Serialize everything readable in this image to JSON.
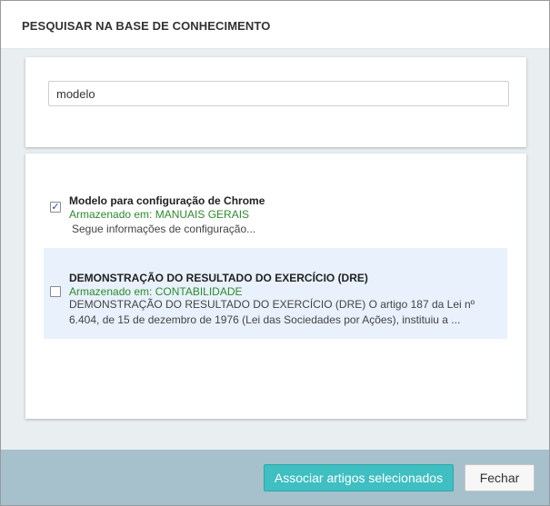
{
  "modal": {
    "title": "PESQUISAR NA BASE DE CONHECIMENTO"
  },
  "search": {
    "value": "modelo"
  },
  "results": [
    {
      "checked": true,
      "title": "Modelo para configuração de Chrome",
      "location": "Armazenado em: MANUAIS GERAIS",
      "snippet": "Segue informações de configuração..."
    },
    {
      "checked": false,
      "title": "DEMONSTRAÇÃO DO RESULTADO DO EXERCÍCIO (DRE)",
      "location": "Armazenado em: CONTABILIDADE",
      "snippet": "DEMONSTRAÇÃO DO RESULTADO DO EXERCÍCIO (DRE)   O artigo 187 da Lei nº 6.404, de 15 de dezembro de 1976 (Lei das Sociedades por Ações), instituiu a ..."
    }
  ],
  "footer": {
    "associate_label": "Associar artigos selecionados",
    "close_label": "Fechar"
  },
  "colors": {
    "primary": "#3fbfc2",
    "location_text": "#2e8a2e",
    "highlight_row": "#e8f1fc",
    "footer_bg": "#a6c0cc"
  }
}
